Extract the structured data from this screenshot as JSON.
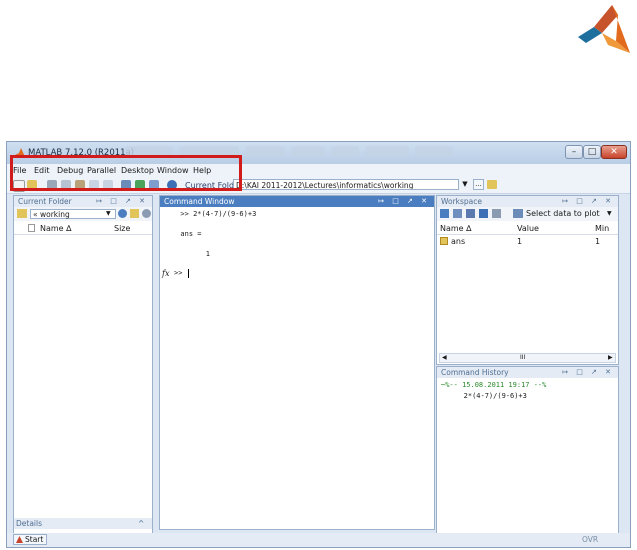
{
  "app": {
    "title": "MATLAB  7.12.0 (R2011a)"
  },
  "menu": [
    "File",
    "Edit",
    "Debug",
    "Parallel",
    "Desktop",
    "Window",
    "Help"
  ],
  "toolbar": {
    "current_folder_label": "Current Folder:",
    "current_folder_path": "D:\\KAI 2011-2012\\Lectures\\informatics\\working",
    "browse_label": "..."
  },
  "current_folder_panel": {
    "title": "Current Folder",
    "folder": "« working",
    "columns": [
      "Name ∆",
      "Size"
    ],
    "details_label": "Details",
    "collapse_glyph": "^"
  },
  "command_window": {
    "title": "Command Window",
    "lines": [
      "  >> 2*(4-7)/(9-6)+3",
      "",
      "  ans =",
      "",
      "        1",
      ""
    ],
    "prompt": ">> ",
    "fx_label": "fx"
  },
  "workspace": {
    "title": "Workspace",
    "select_label": "Select data to plot",
    "columns": [
      "Name ∆",
      "Value",
      "Min"
    ],
    "rows": [
      {
        "name": "ans",
        "value": "1",
        "min": "1"
      }
    ],
    "scroll_glyph": "III"
  },
  "history": {
    "title": "Command History",
    "lines": [
      "─%-- 15.08.2011 19:17 --%",
      "   2*(4-7)/(9-6)+3"
    ]
  },
  "statusbar": {
    "start_label": "Start",
    "ovr_label": "OVR"
  },
  "colors": {
    "accent": "#4a7ec0",
    "highlight": "#d21b1b",
    "logo_orange": "#e16a1d",
    "logo_blue": "#1e6f9e"
  }
}
